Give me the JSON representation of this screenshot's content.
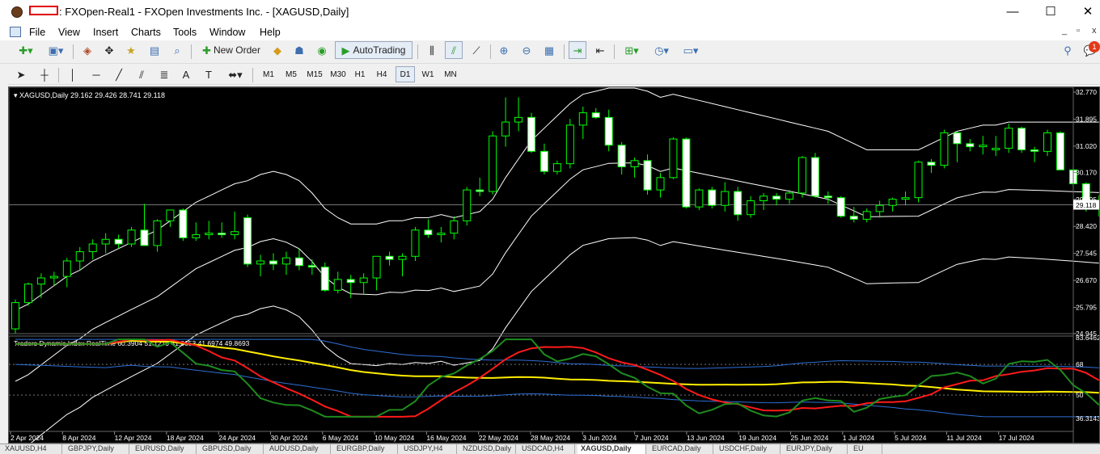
{
  "window": {
    "title": ": FXOpen-Real1 - FXOpen Investments Inc. - [XAGUSD,Daily]",
    "minimize_glyph": "—",
    "maximize_glyph": "☐",
    "close_glyph": "✕"
  },
  "menu": {
    "items": [
      "File",
      "View",
      "Insert",
      "Charts",
      "Tools",
      "Window",
      "Help"
    ],
    "mdi_controls": [
      "_",
      "▫",
      "x"
    ]
  },
  "toolbar": {
    "new_order_label": "New Order",
    "autotrading_label": "AutoTrading",
    "notification_count": "1"
  },
  "timeframes": {
    "items": [
      "M1",
      "M5",
      "M15",
      "M30",
      "H1",
      "H4",
      "D1",
      "W1",
      "MN"
    ],
    "active": "D1"
  },
  "chart": {
    "header": "XAGUSD,Daily  29.162 29.426 28.741 29.118",
    "current_price_label": "29.118",
    "price_ticks": [
      "32.770",
      "31.895",
      "31.020",
      "30.170",
      "29.295",
      "28.420",
      "27.545",
      "26.670",
      "25.795",
      "24.945"
    ],
    "indicator_header": "Traders Dynamic Index RealTime 60.3904 51.1279 41.8653 41.6974 49.8693",
    "indicator_ticks": [
      "83.6462",
      "68",
      "50",
      "36.3143"
    ],
    "date_labels": [
      "2 Apr 2024",
      "8 Apr 2024",
      "12 Apr 2024",
      "18 Apr 2024",
      "24 Apr 2024",
      "30 Apr 2024",
      "6 May 2024",
      "10 May 2024",
      "16 May 2024",
      "22 May 2024",
      "28 May 2024",
      "3 Jun 2024",
      "7 Jun 2024",
      "13 Jun 2024",
      "19 Jun 2024",
      "25 Jun 2024",
      "1 Jul 2024",
      "5 Jul 2024",
      "11 Jul 2024",
      "17 Jul 2024"
    ],
    "colors": {
      "background": "#000000",
      "bull_body": "#000000",
      "bear_body": "#ffffff",
      "wick": "#00ff00",
      "bands": "#ffffff",
      "tdi_green": "#1e8c1e",
      "tdi_red": "#ff1a1a",
      "tdi_yellow": "#ffee00",
      "tdi_blue": "#2f6fd6"
    }
  },
  "chart_data": {
    "type": "candlestick",
    "symbol": "XAGUSD",
    "timeframe": "Daily",
    "ylim": [
      24.945,
      32.77
    ],
    "ohlc": [
      [
        25.1,
        26.05,
        24.95,
        25.95
      ],
      [
        25.95,
        26.6,
        25.85,
        26.55
      ],
      [
        26.55,
        26.9,
        26.1,
        26.75
      ],
      [
        26.75,
        26.95,
        26.5,
        26.8
      ],
      [
        26.8,
        27.4,
        26.45,
        27.3
      ],
      [
        27.3,
        27.75,
        27.0,
        27.6
      ],
      [
        27.6,
        28.0,
        27.35,
        27.85
      ],
      [
        27.85,
        28.2,
        27.55,
        28.0
      ],
      [
        28.0,
        28.15,
        27.7,
        27.85
      ],
      [
        27.85,
        28.4,
        27.75,
        28.3
      ],
      [
        28.3,
        29.15,
        28.2,
        27.8
      ],
      [
        27.8,
        28.65,
        27.6,
        28.6
      ],
      [
        28.6,
        28.95,
        28.4,
        28.95
      ],
      [
        28.95,
        29.0,
        27.95,
        28.05
      ],
      [
        28.05,
        28.55,
        27.95,
        28.15
      ],
      [
        28.15,
        28.6,
        28.0,
        28.2
      ],
      [
        28.2,
        28.55,
        28.05,
        28.15
      ],
      [
        28.15,
        28.9,
        28.0,
        28.25
      ],
      [
        28.7,
        28.8,
        27.1,
        27.2
      ],
      [
        27.2,
        27.5,
        26.8,
        27.3
      ],
      [
        27.3,
        27.55,
        27.0,
        27.2
      ],
      [
        27.2,
        27.6,
        26.85,
        27.4
      ],
      [
        27.4,
        27.7,
        27.0,
        27.15
      ],
      [
        27.15,
        27.35,
        26.85,
        27.1
      ],
      [
        27.1,
        27.25,
        26.3,
        26.35
      ],
      [
        26.35,
        26.95,
        26.25,
        26.7
      ],
      [
        26.7,
        26.85,
        26.1,
        26.6
      ],
      [
        26.6,
        26.9,
        26.2,
        26.75
      ],
      [
        26.75,
        27.15,
        26.35,
        27.45
      ],
      [
        27.45,
        27.6,
        27.15,
        27.35
      ],
      [
        27.35,
        27.55,
        26.8,
        27.45
      ],
      [
        27.45,
        28.4,
        27.3,
        28.3
      ],
      [
        28.3,
        28.65,
        28.05,
        28.15
      ],
      [
        28.15,
        28.4,
        27.9,
        28.2
      ],
      [
        28.2,
        28.75,
        28.0,
        28.6
      ],
      [
        28.6,
        29.7,
        28.45,
        29.6
      ],
      [
        29.6,
        30.0,
        29.4,
        29.55
      ],
      [
        29.55,
        31.5,
        29.45,
        31.35
      ],
      [
        31.35,
        32.6,
        31.0,
        31.8
      ],
      [
        31.8,
        32.6,
        31.5,
        31.95
      ],
      [
        31.95,
        32.1,
        30.8,
        30.85
      ],
      [
        30.85,
        31.1,
        30.1,
        30.2
      ],
      [
        30.2,
        30.55,
        30.1,
        30.45
      ],
      [
        30.45,
        31.9,
        30.3,
        31.7
      ],
      [
        31.7,
        32.3,
        31.25,
        32.1
      ],
      [
        32.1,
        32.25,
        31.9,
        31.95
      ],
      [
        31.95,
        32.2,
        30.85,
        31.05
      ],
      [
        31.05,
        31.15,
        30.1,
        30.35
      ],
      [
        30.35,
        30.65,
        30.0,
        30.55
      ],
      [
        30.55,
        30.75,
        29.45,
        29.6
      ],
      [
        29.6,
        30.15,
        29.35,
        30.0
      ],
      [
        30.0,
        31.3,
        29.95,
        31.25
      ],
      [
        31.25,
        31.3,
        29.0,
        29.05
      ],
      [
        29.05,
        29.65,
        28.95,
        29.6
      ],
      [
        29.6,
        29.7,
        29.0,
        29.1
      ],
      [
        29.1,
        29.85,
        28.9,
        29.55
      ],
      [
        29.55,
        29.7,
        28.6,
        28.8
      ],
      [
        28.8,
        29.4,
        28.7,
        29.25
      ],
      [
        29.25,
        29.5,
        28.95,
        29.4
      ],
      [
        29.4,
        29.5,
        29.1,
        29.3
      ],
      [
        29.3,
        29.6,
        29.15,
        29.5
      ],
      [
        29.5,
        30.7,
        29.35,
        30.65
      ],
      [
        30.65,
        30.8,
        29.35,
        29.4
      ],
      [
        29.4,
        29.55,
        29.15,
        29.35
      ],
      [
        29.35,
        29.4,
        28.7,
        28.75
      ],
      [
        28.75,
        29.05,
        28.55,
        28.65
      ],
      [
        28.65,
        29.0,
        28.55,
        28.9
      ],
      [
        28.9,
        29.25,
        28.7,
        29.1
      ],
      [
        29.1,
        29.35,
        28.9,
        29.3
      ],
      [
        29.3,
        29.55,
        29.1,
        29.35
      ],
      [
        29.35,
        30.55,
        29.2,
        30.5
      ],
      [
        30.5,
        30.6,
        30.15,
        30.4
      ],
      [
        30.4,
        31.55,
        30.3,
        31.45
      ],
      [
        31.45,
        31.5,
        30.5,
        31.1
      ],
      [
        31.1,
        31.25,
        30.85,
        31.0
      ],
      [
        31.0,
        31.35,
        30.75,
        31.05
      ],
      [
        30.9,
        31.35,
        30.7,
        30.95
      ],
      [
        30.95,
        31.75,
        30.8,
        31.6
      ],
      [
        31.6,
        31.65,
        30.8,
        30.9
      ],
      [
        30.9,
        31.0,
        30.5,
        30.85
      ],
      [
        30.85,
        31.55,
        30.7,
        31.45
      ],
      [
        31.45,
        31.5,
        30.25,
        30.25
      ],
      [
        30.25,
        30.35,
        29.7,
        29.8
      ],
      [
        29.8,
        29.85,
        28.9,
        29.15
      ],
      [
        29.16,
        29.43,
        28.74,
        29.12
      ]
    ],
    "bollinger": {
      "upper": [
        25.7,
        25.9,
        26.2,
        26.5,
        26.8,
        27.0,
        27.3,
        27.5,
        27.7,
        27.9,
        28.1,
        28.3,
        28.6,
        28.9,
        29.2,
        29.4,
        29.6,
        29.8,
        29.9,
        30.1,
        30.2,
        30.1,
        29.9,
        29.5,
        29.0,
        28.7,
        28.5,
        28.5,
        28.5,
        28.6,
        28.6,
        28.7,
        28.7,
        28.8,
        28.7,
        28.8,
        28.9,
        29.3,
        30.0,
        30.6,
        31.2,
        31.6,
        32.0,
        32.4,
        32.7,
        32.8,
        32.9,
        32.9,
        32.9,
        32.8,
        32.6,
        32.7,
        32.6,
        32.5,
        32.4,
        32.3,
        32.2,
        32.1,
        32.0,
        31.9,
        31.8,
        31.7,
        31.6,
        31.5,
        31.3,
        31.1,
        30.9,
        30.9,
        30.9,
        30.9,
        30.9,
        31.1,
        31.3,
        31.5,
        31.6,
        31.7,
        31.7,
        31.8,
        31.8,
        31.8,
        31.8,
        31.8,
        31.8,
        31.8,
        31.8
      ]
    },
    "tdi": {
      "ylim": [
        36.3143,
        83.6462
      ],
      "levels": [
        68,
        50
      ]
    }
  },
  "tabs": [
    "XAUUSD,H4",
    "GBPJPY,Daily",
    "EURUSD,Daily",
    "GBPUSD,Daily",
    "AUDUSD,Daily",
    "EURGBP,Daily",
    "USDJPY,H4",
    "NZDUSD,Daily",
    "USDCAD,H4",
    "XAGUSD,Daily",
    "EURCAD,Daily",
    "USDCHF,Daily",
    "EURJPY,Daily",
    "EU"
  ]
}
